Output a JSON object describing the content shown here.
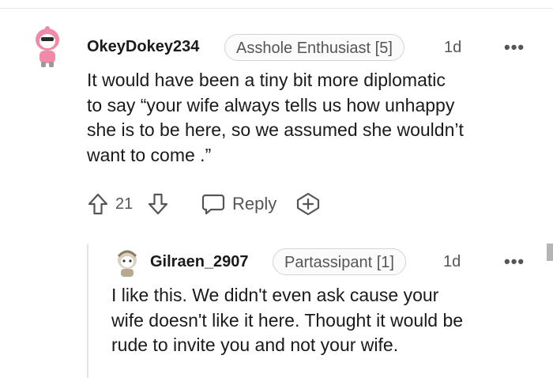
{
  "comment": {
    "username": "OkeyDokey234",
    "flair": "Asshole Enthusiast [5]",
    "age": "1d",
    "more": "•••",
    "body_lines": [
      "It would have been a tiny bit more diplomatic",
      "to say “your wife always tells us how unhappy",
      "she is to be here, so we assumed she wouldn’t",
      "want to come .”"
    ],
    "score": "21",
    "reply_label": "Reply",
    "icons": {
      "upvote": "upvote-arrow-icon",
      "downvote": "downvote-arrow-icon",
      "reply": "reply-bubble-icon",
      "award": "award-plus-icon"
    }
  },
  "reply": {
    "username": "Gilraen_2907",
    "flair": "Partassipant [1]",
    "age": "1d",
    "more": "•••",
    "body_lines": [
      "I like this. We didn't even ask cause your",
      "wife doesn't like it here. Thought it would be",
      "rude to invite you and not your wife."
    ]
  },
  "colors": {
    "text": "#1a1a1b",
    "muted": "#555555",
    "avatar_pink": "#f08aa8",
    "flair_border": "#d4d4d4"
  }
}
